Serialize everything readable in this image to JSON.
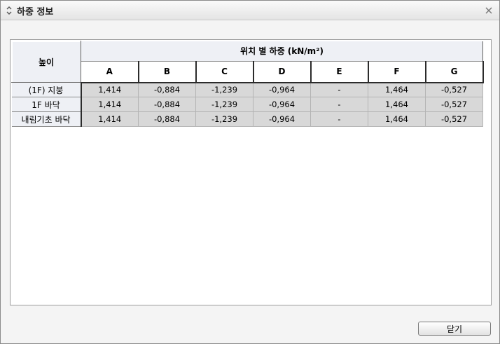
{
  "window": {
    "title": "하중 정보",
    "title_icon": "chevron-up-down-icon",
    "close_icon": "close-icon"
  },
  "table": {
    "height_header": "높이",
    "group_header": "위치 별 하중 (kN/m²)",
    "columns": [
      "A",
      "B",
      "C",
      "D",
      "E",
      "F",
      "G"
    ],
    "rows": [
      {
        "label": "(1F) 지붕",
        "values": [
          "1,414",
          "-0,884",
          "-1,239",
          "-0,964",
          "-",
          "1,464",
          "-0,527"
        ]
      },
      {
        "label": "1F 바닥",
        "values": [
          "1,414",
          "-0,884",
          "-1,239",
          "-0,964",
          "-",
          "1,464",
          "-0,527"
        ]
      },
      {
        "label": "내림기초 바닥",
        "values": [
          "1,414",
          "-0,884",
          "-1,239",
          "-0,964",
          "-",
          "1,464",
          "-0,527"
        ]
      }
    ]
  },
  "buttons": {
    "close_label": "닫기"
  }
}
